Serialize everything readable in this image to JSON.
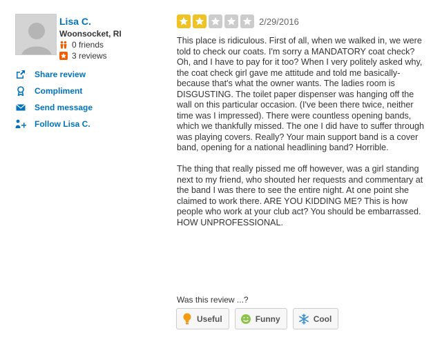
{
  "user": {
    "name": "Lisa C.",
    "location": "Woonsocket, RI",
    "friends": "0 friends",
    "reviews": "3 reviews"
  },
  "actions": [
    {
      "label": "Share review",
      "icon": "share-icon"
    },
    {
      "label": "Compliment",
      "icon": "compliment-icon"
    },
    {
      "label": "Send message",
      "icon": "envelope-icon"
    },
    {
      "label": "Follow Lisa C.",
      "icon": "follow-icon"
    }
  ],
  "review": {
    "rating": 2,
    "rating_max": 5,
    "date": "2/29/2016",
    "paragraphs": [
      "This place is ridiculous. First of all, when we walked in, we were told to check our coats. I'm sorry a MANDATORY coat check? Oh, and I have to pay for it too? When I very politely asked why, the coat check girl gave me attitude and told me basically- because that's what the owner wants. The ladies room is DISGUSTING. The toilet paper dispenser was hanging off the wall on this particular occasion. (I've been there twice, neither time was I impressed). There were countless opening bands, which we thankfully missed. The one I did have to suffer through was playing covers. Really? Your main support band is a cover band, opening for a national headlining band? Horrible.",
      "The thing that really pissed me off however, was a girl standing next to my friend, who shouted her requests and commentary at the band I was there to see the entire night. At one point she claimed to work there. ARE YOU KIDDING ME? This is how people who work at your club act? You should be embarrassed. HOW UNPROFESSIONAL."
    ]
  },
  "vote": {
    "question": "Was this review ...?",
    "buttons": [
      {
        "label": "Useful",
        "icon": "lightbulb-icon"
      },
      {
        "label": "Funny",
        "icon": "smiley-icon"
      },
      {
        "label": "Cool",
        "icon": "snowflake-icon"
      }
    ]
  },
  "colors": {
    "link": "#0073bb",
    "star_on": "#f0c324",
    "star_off": "#cccccc",
    "brand_red": "#d32323"
  }
}
